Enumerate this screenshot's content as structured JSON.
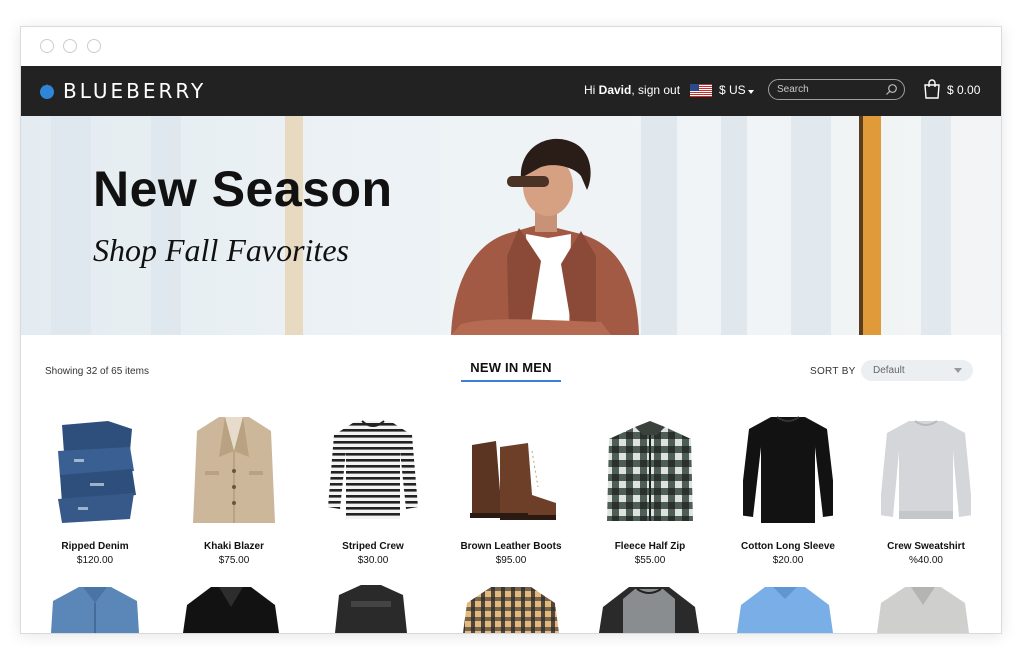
{
  "browser": {
    "window_controls": [
      "close",
      "minimize",
      "maximize"
    ]
  },
  "header": {
    "brand": "BLUEBERRY",
    "logo_icon": "blueberry-logo-icon",
    "greeting_prefix": "Hi ",
    "user_name": "David",
    "signout_text": ", sign out",
    "flag_icon": "us-flag-icon",
    "currency": "$ US",
    "search_placeholder": "Search",
    "cart_icon": "shopping-bag-icon",
    "cart_total": "$ 0.00",
    "background": "#222222"
  },
  "hero": {
    "title": "New Season",
    "subtitle": "Shop Fall Favorites"
  },
  "listing": {
    "count_text": "Showing 32 of 65 items",
    "section_title": "NEW IN MEN",
    "sort_label": "SORT BY",
    "sort_value": "Default",
    "accent": "#3d7fd6"
  },
  "products": [
    {
      "name": "Ripped Denim",
      "price": "$120.00",
      "icon": "folded-jeans"
    },
    {
      "name": "Khaki Blazer",
      "price": "$75.00",
      "icon": "blazer"
    },
    {
      "name": "Striped Crew",
      "price": "$30.00",
      "icon": "striped-shirt"
    },
    {
      "name": "Brown Leather Boots",
      "price": "$95.00",
      "icon": "boot"
    },
    {
      "name": "Fleece Half Zip",
      "price": "$55.00",
      "icon": "plaid-fleece"
    },
    {
      "name": "Cotton Long Sleeve",
      "price": "$20.00",
      "icon": "black-long-sleeve"
    },
    {
      "name": "Crew Sweatshirt",
      "price": "%40.00",
      "icon": "grey-sweatshirt"
    }
  ],
  "next_row": [
    "denim-shirt",
    "leather-jacket",
    "folded-jacket",
    "plaid-shirt",
    "raglan-tee",
    "polo-shirt",
    "grey-jacket"
  ]
}
